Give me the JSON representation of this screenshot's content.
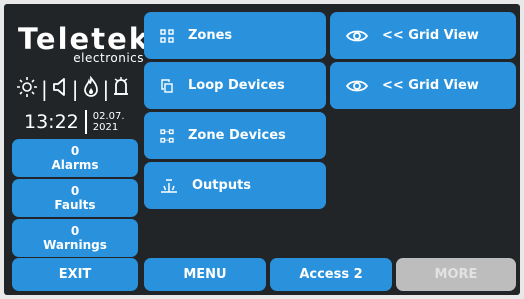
{
  "brand": {
    "name": "Teletek",
    "sub": "electronics"
  },
  "clock": {
    "time": "13:22",
    "date_line1": "02.07.",
    "date_line2": "2021"
  },
  "status_icons": [
    "brightness-icon",
    "speaker-icon",
    "flame-icon",
    "bell-icon"
  ],
  "counters": {
    "alarms": {
      "count": "0",
      "label": "Alarms"
    },
    "faults": {
      "count": "0",
      "label": "Faults"
    },
    "warnings": {
      "count": "0",
      "label": "Warnings"
    }
  },
  "menu": {
    "zones": "Zones",
    "loop_devices": "Loop Devices",
    "zone_devices": "Zone Devices",
    "outputs": "Outputs"
  },
  "grid_view": {
    "row1": "<< Grid View",
    "row2": "<< Grid View"
  },
  "bottom": {
    "exit": "EXIT",
    "menu": "MENU",
    "access": "Access 2",
    "more": "MORE"
  },
  "colors": {
    "button": "#2a92dc",
    "disabled": "#bdbdbd",
    "background": "#222528"
  }
}
